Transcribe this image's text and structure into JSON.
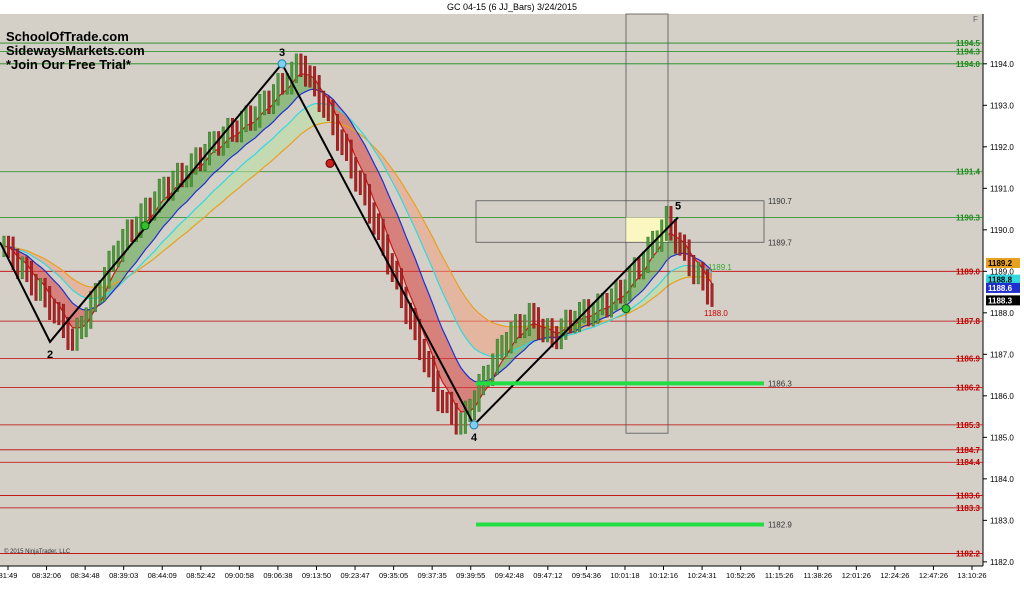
{
  "window": {
    "title": "GC 04-15 (6 JJ_Bars)  3/24/2015",
    "copyright": "© 2015 NinjaTrader, LLC"
  },
  "watermark": {
    "line1": "SchoolOfTrade.com",
    "line2": "SidewaysMarkets.com",
    "line3": "*Join Our Free Trial*"
  },
  "colors": {
    "background": "#d4d0c8",
    "bull_bar": "#4f9a3b",
    "bear_bar": "#b22222",
    "zigzag": "#000000",
    "green_level": "#1a8a1a",
    "red_level": "#c00000",
    "bright_green": "#22dd44"
  },
  "chart_data": {
    "type": "bar",
    "title": "GC 04-15 (6 JJ_Bars)  3/24/2015",
    "instrument": "GC 04-15",
    "bar_type": "6 JJ_Bars",
    "date": "3/24/2015",
    "ylim": [
      1181.9,
      1195.2
    ],
    "x_tick_labels": [
      "31:49",
      "08:32:06",
      "08:34:48",
      "08:39:03",
      "08:44:09",
      "08:52:42",
      "09:00:58",
      "09:06:38",
      "09:13:50",
      "09:23:47",
      "09:35:05",
      "09:37:35",
      "09:39:55",
      "09:42:48",
      "09:47:12",
      "09:54:36",
      "10:01:18",
      "10:12:16",
      "10:24:31",
      "10:52:26",
      "11:15:26",
      "11:38:26",
      "12:01:26",
      "12:24:26",
      "12:47:26",
      "13:10:26"
    ],
    "y_tick_labels": [
      "1194.0",
      "1193.0",
      "1192.0",
      "1191.0",
      "1190.0",
      "1189.0",
      "1188.0",
      "1187.0",
      "1186.0",
      "1185.0",
      "1184.0",
      "1183.0",
      "1182.0"
    ],
    "price_path": [
      1189.6,
      1188.9,
      1188.2,
      1187.3,
      1188.4,
      1189.6,
      1190.3,
      1191.0,
      1191.4,
      1192.0,
      1192.4,
      1192.8,
      1193.4,
      1194.0,
      1193.0,
      1191.8,
      1190.5,
      1189.0,
      1187.5,
      1186.0,
      1185.3,
      1186.4,
      1187.4,
      1187.9,
      1187.4,
      1187.9,
      1188.1,
      1188.5,
      1189.3,
      1190.2,
      1189.2,
      1188.4
    ],
    "zigzag_points": [
      {
        "label": "2",
        "price": 1187.3
      },
      {
        "label": "3",
        "price": 1194.0
      },
      {
        "label": "4",
        "price": 1185.3
      },
      {
        "label": "5",
        "price": 1190.3
      }
    ],
    "right_axis_labels": [
      {
        "text": "1194.5",
        "price": 1194.5,
        "color": "green"
      },
      {
        "text": "1194.3",
        "price": 1194.3,
        "color": "green"
      },
      {
        "text": "1194.0",
        "price": 1194.0,
        "color": "green"
      },
      {
        "text": "1191.4",
        "price": 1191.4,
        "color": "green"
      },
      {
        "text": "1190.3",
        "price": 1190.3,
        "color": "green"
      },
      {
        "text": "1189.2",
        "price": 1189.2,
        "color": "orange"
      },
      {
        "text": "1189.0",
        "price": 1189.0,
        "color": "red"
      },
      {
        "text": "1188.8",
        "price": 1188.8,
        "color": "cyan"
      },
      {
        "text": "1188.6",
        "price": 1188.6,
        "color": "blue"
      },
      {
        "text": "1188.3",
        "price": 1188.3,
        "color": "black"
      },
      {
        "text": "1187.8",
        "price": 1187.8,
        "color": "red"
      },
      {
        "text": "1186.9",
        "price": 1186.9,
        "color": "red"
      },
      {
        "text": "1186.2",
        "price": 1186.2,
        "color": "red"
      },
      {
        "text": "1185.3",
        "price": 1185.3,
        "color": "red"
      },
      {
        "text": "1184.7",
        "price": 1184.7,
        "color": "red"
      },
      {
        "text": "1184.4",
        "price": 1184.4,
        "color": "red"
      },
      {
        "text": "1183.6",
        "price": 1183.6,
        "color": "red"
      },
      {
        "text": "1183.3",
        "price": 1183.3,
        "color": "red"
      },
      {
        "text": "1182.2",
        "price": 1182.2,
        "color": "red"
      }
    ],
    "inline_labels": [
      {
        "text": "1190.7",
        "price": 1190.7
      },
      {
        "text": "1189.7",
        "price": 1189.7
      },
      {
        "text": "1189.1",
        "price": 1189.1
      },
      {
        "text": "1188.0",
        "price": 1188.0
      },
      {
        "text": "1186.3",
        "price": 1186.3
      },
      {
        "text": "1182.9",
        "price": 1182.9
      }
    ],
    "bright_green_levels": [
      1186.3,
      1182.9
    ],
    "grid": false,
    "legend": "none"
  }
}
